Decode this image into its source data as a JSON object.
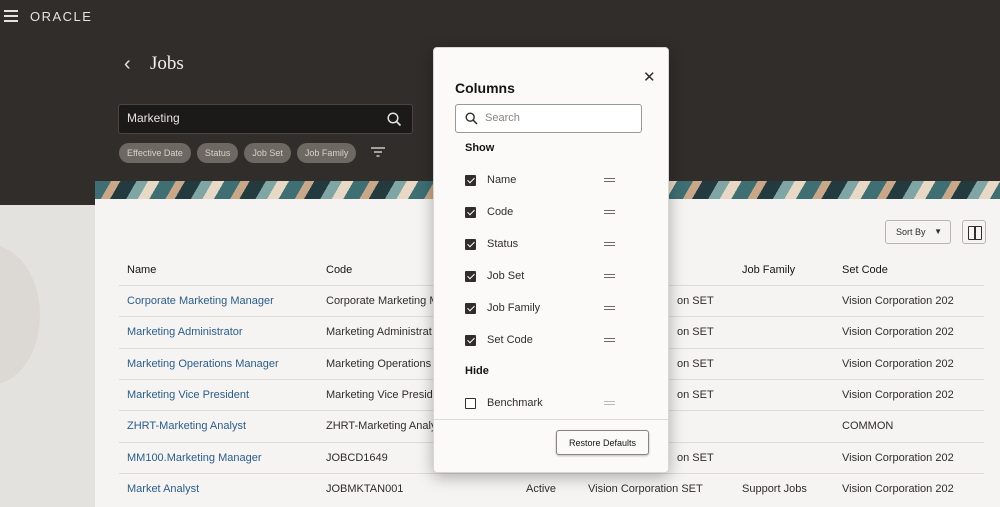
{
  "header": {
    "logo": "ORACLE",
    "title": "Jobs",
    "back": "‹"
  },
  "search": {
    "value": "Marketing"
  },
  "filters": [
    "Effective Date",
    "Status",
    "Job Set",
    "Job Family"
  ],
  "toolbar": {
    "sort_label": "Sort By"
  },
  "table": {
    "columns": [
      "Name",
      "Code",
      "",
      "",
      "Job Family",
      "Set Code"
    ],
    "rows": [
      {
        "name": "Corporate Marketing Manager",
        "code": "Corporate Marketing M",
        "status": "",
        "set": "on SET",
        "family": "",
        "setcode": "Vision Corporation 202"
      },
      {
        "name": "Marketing Administrator",
        "code": "Marketing Administrat",
        "status": "",
        "set": "on SET",
        "family": "",
        "setcode": "Vision Corporation 202"
      },
      {
        "name": "Marketing Operations Manager",
        "code": "Marketing Operations",
        "status": "",
        "set": "on SET",
        "family": "",
        "setcode": "Vision Corporation 202"
      },
      {
        "name": "Marketing Vice President",
        "code": "Marketing Vice Preside",
        "status": "",
        "set": "on SET",
        "family": "",
        "setcode": "Vision Corporation 202"
      },
      {
        "name": "ZHRT-Marketing Analyst",
        "code": "ZHRT-Marketing Analy",
        "status": "",
        "set": "",
        "family": "",
        "setcode": "COMMON"
      },
      {
        "name": "MM100.Marketing Manager",
        "code": "JOBCD1649",
        "status": "",
        "set": "on SET",
        "family": "",
        "setcode": "Vision Corporation 202"
      },
      {
        "name": "Market Analyst",
        "code": "JOBMKTAN001",
        "status": "Active",
        "set": "Vision Corporation SET",
        "family": "Support Jobs",
        "setcode": "Vision Corporation 202"
      }
    ]
  },
  "dialog": {
    "title": "Columns",
    "close": "✕",
    "search_placeholder": "Search",
    "show_label": "Show",
    "hide_label": "Hide",
    "show_items": [
      "Name",
      "Code",
      "Status",
      "Job Set",
      "Job Family",
      "Set Code"
    ],
    "hide_items": [
      "Benchmark"
    ],
    "restore_label": "Restore Defaults"
  }
}
